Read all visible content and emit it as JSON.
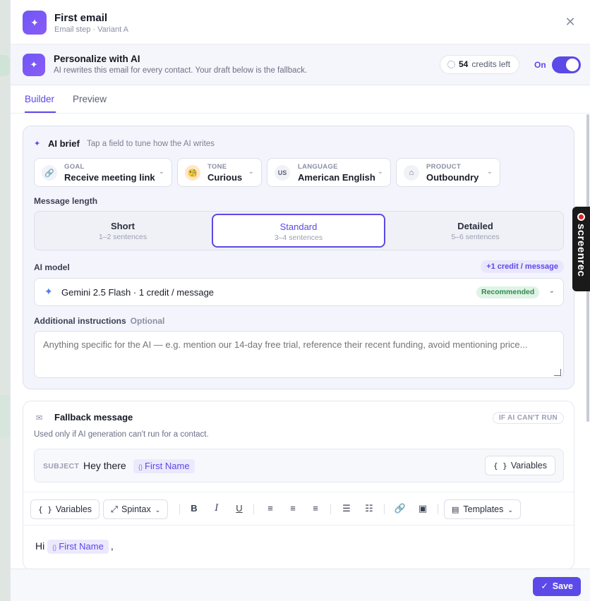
{
  "header": {
    "title": "First email",
    "subtitle": "Email step · Variant A",
    "close_glyph": "✕"
  },
  "personalize": {
    "title": "Personalize with AI",
    "subtitle": "AI rewrites this email for every contact. Your draft below is the fallback.",
    "credits_count": "54",
    "credits_label": "credits left",
    "toggle_label": "On",
    "toggle_state": "on"
  },
  "tabs": [
    {
      "label": "Builder",
      "active": true
    },
    {
      "label": "Preview",
      "active": false
    }
  ],
  "brief": {
    "title": "AI brief",
    "hint": "Tap a field to tune how the AI writes",
    "fields": [
      {
        "label": "GOAL",
        "value": "Receive meeting link",
        "icon": "link-icon"
      },
      {
        "label": "TONE",
        "value": "Curious",
        "icon": "curious-face-icon"
      },
      {
        "label": "LANGUAGE",
        "value": "American English",
        "icon": "US"
      },
      {
        "label": "PRODUCT",
        "value": "Outboundry",
        "icon": "tag-icon"
      }
    ],
    "length_label": "Message length",
    "length_options": [
      {
        "title": "Short",
        "sub": "1–2 sentences"
      },
      {
        "title": "Standard",
        "sub": "3–4 sentences",
        "selected": true
      },
      {
        "title": "Detailed",
        "sub": "5–6 sentences"
      }
    ],
    "model_label": "AI model",
    "model_cost": "+1 credit / message",
    "model_value": "Gemini 2.5 Flash · 1 credit / message",
    "model_badge": "Recommended",
    "instructions_label": "Additional instructions",
    "instructions_optional": "Optional",
    "instructions_placeholder": "Anything specific for the AI — e.g. mention our 14-day free trial, reference their recent funding, avoid mentioning price..."
  },
  "fallback": {
    "title": "Fallback message",
    "badge": "IF AI CAN'T RUN",
    "subtitle": "Used only if AI generation can't run for a contact.",
    "subject_key": "SUBJECT",
    "subject_text": "Hey there",
    "subject_var": "First Name",
    "variables_label": "Variables",
    "toolbar": {
      "variables": "Variables",
      "spintax": "Spintax",
      "templates": "Templates"
    },
    "body_greeting": "Hi",
    "body_var": "First Name",
    "body_tail": ","
  },
  "footer": {
    "save_label": "Save"
  },
  "recorder": {
    "label": "screenrec"
  },
  "colors": {
    "accent": "#5b49e8",
    "recommended_bg": "#dff3e6",
    "recommended_fg": "#2f8a4f"
  }
}
